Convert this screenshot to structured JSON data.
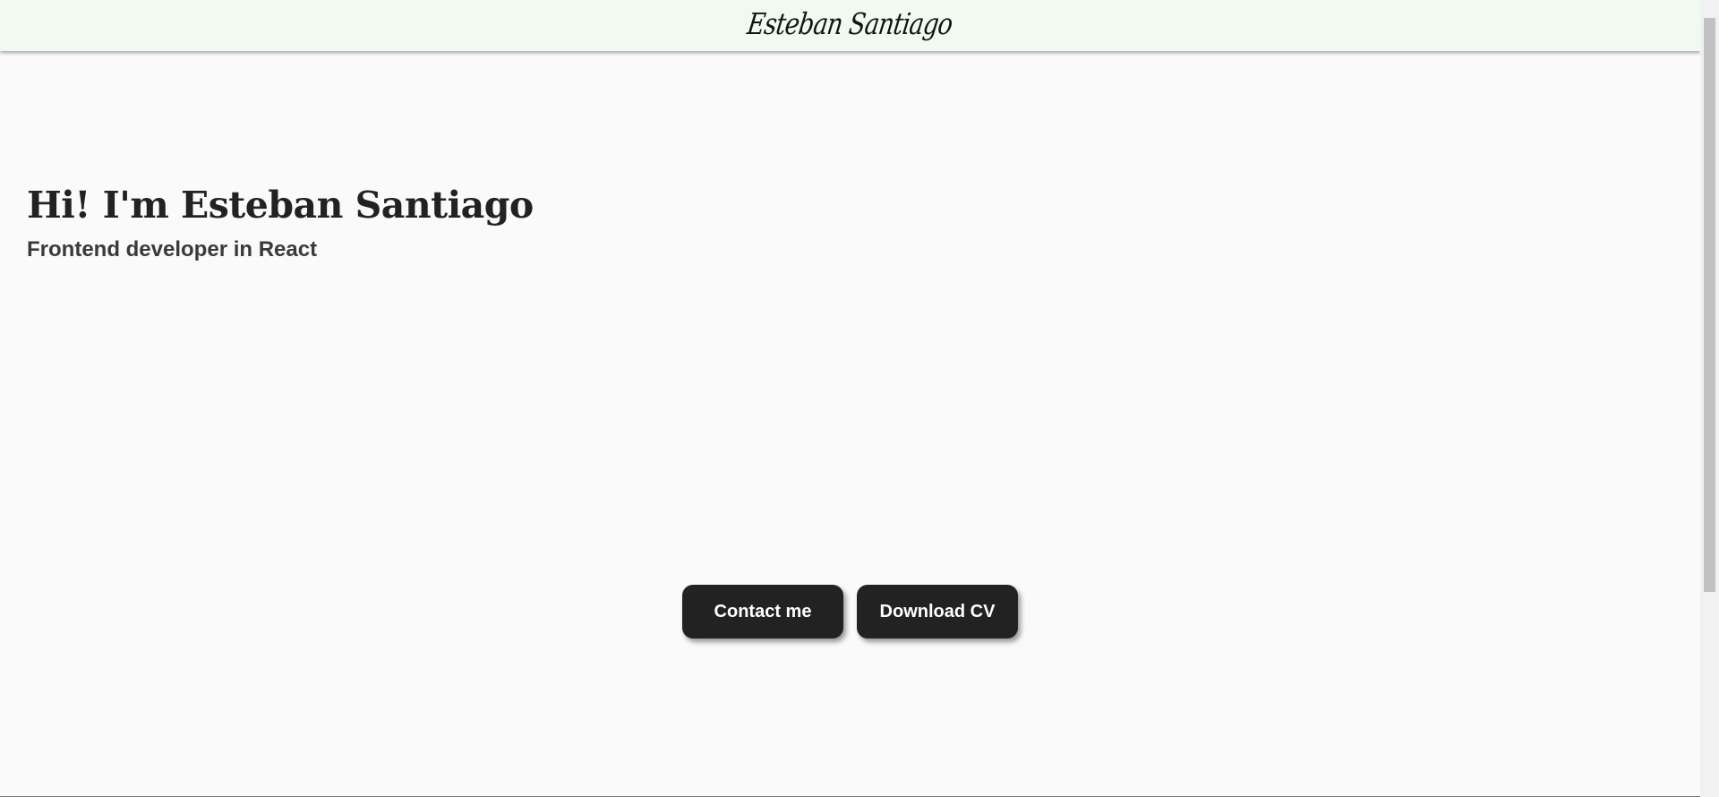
{
  "header": {
    "logo_text": "Esteban Santiago",
    "background": "#f0faf0"
  },
  "hero": {
    "title": "Hi! I'm Esteban Santiago",
    "subtitle": "Frontend developer in React"
  },
  "actions": {
    "contact_label": "Contact me",
    "download_label": "Download CV",
    "button_color": "#222222"
  },
  "page": {
    "background": "#fafafa"
  }
}
